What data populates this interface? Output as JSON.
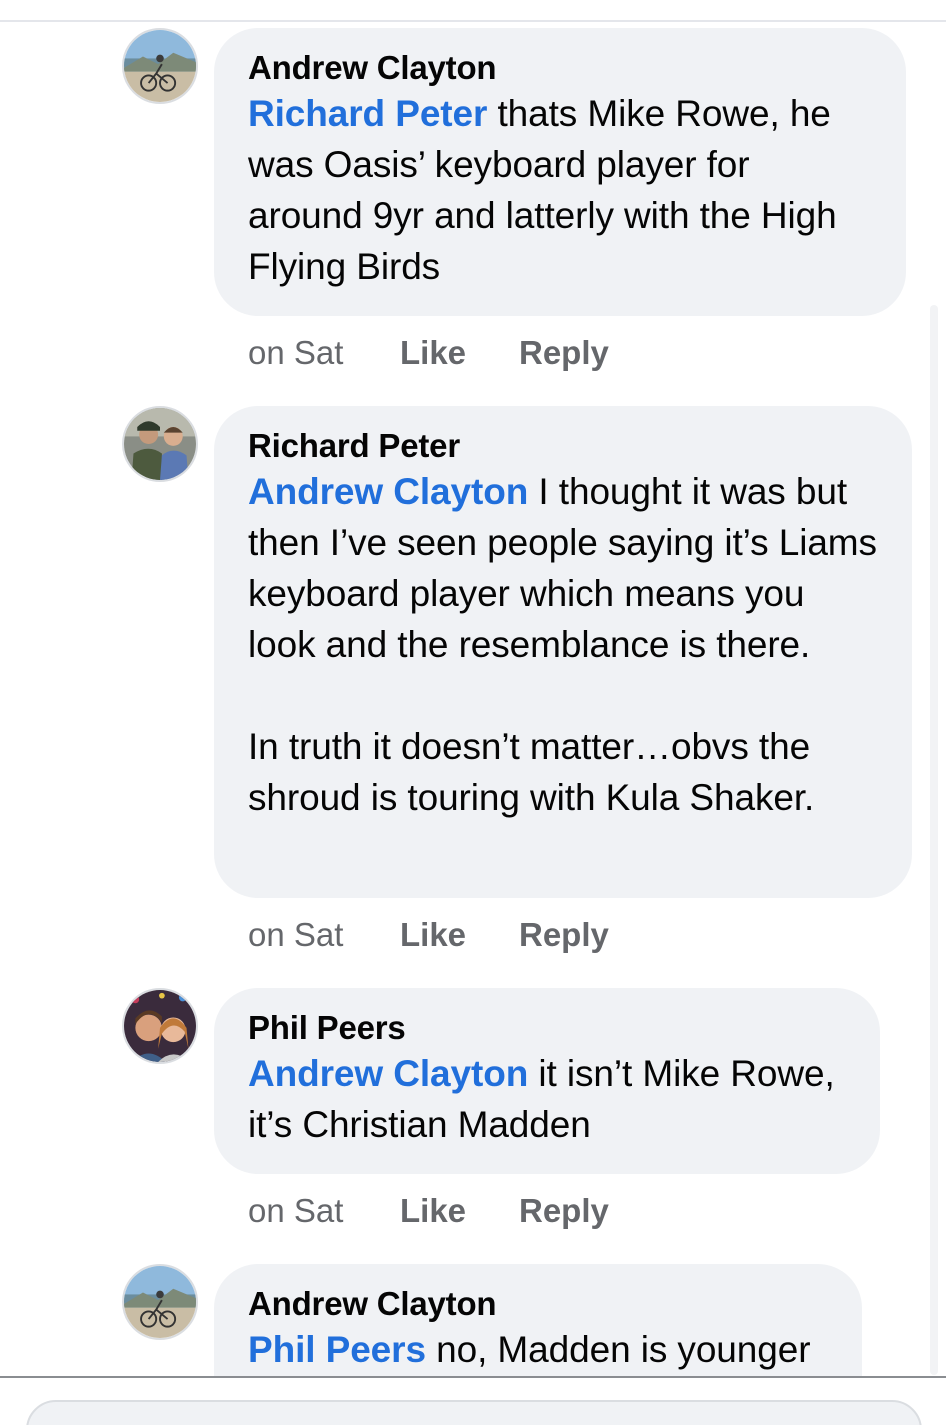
{
  "comments": [
    {
      "author": "Andrew Clayton",
      "mention": "Richard Peter",
      "text": " thats Mike Rowe, he was Oasis’ keyboard player for around 9yr and latterly with the High Flying Birds",
      "timestamp": "on Sat",
      "like_label": "Like",
      "reply_label": "Reply"
    },
    {
      "author": "Richard Peter",
      "mention": "Andrew Clayton",
      "text": " I thought it was but then I’ve seen people saying it’s Liams keyboard player which means you look and the resemblance is there.\n\nIn truth it doesn’t matter…obvs the shroud is touring with Kula Shaker.",
      "timestamp": "on Sat",
      "like_label": "Like",
      "reply_label": "Reply"
    },
    {
      "author": "Phil Peers",
      "mention": "Andrew Clayton",
      "text": " it isn’t Mike Rowe, it’s Christian Madden",
      "timestamp": "on Sat",
      "like_label": "Like",
      "reply_label": "Reply"
    },
    {
      "author": "Andrew Clayton",
      "mention": "Phil Peers",
      "text": " no, Madden is younger"
    }
  ],
  "colors": {
    "mention": "#216fdb",
    "bubble": "#f0f2f5",
    "meta": "#65676b"
  }
}
